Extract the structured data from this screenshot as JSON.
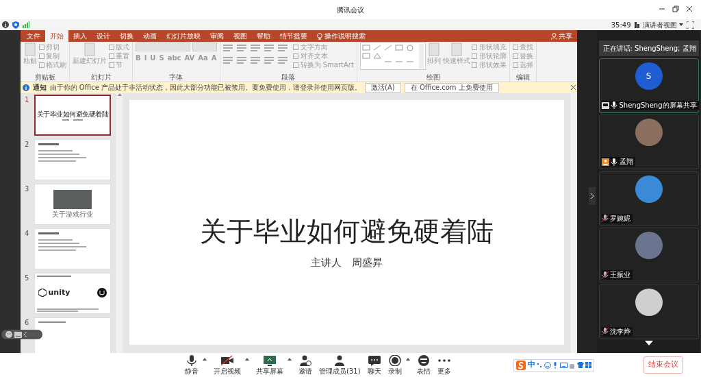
{
  "window": {
    "title": "腾讯会议"
  },
  "status": {
    "timer": "35:49",
    "view_button": "演讲者视图"
  },
  "ppt": {
    "tabs": [
      {
        "label": "文件",
        "selected": false
      },
      {
        "label": "开始",
        "selected": true
      },
      {
        "label": "插入",
        "selected": false
      },
      {
        "label": "设计",
        "selected": false
      },
      {
        "label": "切换",
        "selected": false
      },
      {
        "label": "动画",
        "selected": false
      },
      {
        "label": "幻灯片放映",
        "selected": false
      },
      {
        "label": "审阅",
        "selected": false
      },
      {
        "label": "视图",
        "selected": false
      },
      {
        "label": "帮助",
        "selected": false
      },
      {
        "label": "情节提要",
        "selected": false
      }
    ],
    "search": "操作说明搜索",
    "share": "共享",
    "ribbon_groups": [
      {
        "label": "剪贴板",
        "items": [
          {
            "kind": "large",
            "label": "粘贴"
          },
          {
            "kind": "small",
            "label": "剪切"
          },
          {
            "kind": "small",
            "label": "复制"
          },
          {
            "kind": "small",
            "label": "格式刷"
          }
        ]
      },
      {
        "label": "幻灯片",
        "items": [
          {
            "kind": "large",
            "label": "新建幻灯片"
          },
          {
            "kind": "small",
            "label": "版式"
          },
          {
            "kind": "small",
            "label": "重置"
          },
          {
            "kind": "small",
            "label": "节"
          }
        ]
      },
      {
        "label": "字体",
        "items": [
          {
            "kind": "font",
            "glyphs": [
              "B",
              "I",
              "U",
              "S",
              "abc",
              "AV",
              "Aa",
              "A"
            ]
          }
        ]
      },
      {
        "label": "段落",
        "items": [
          {
            "kind": "paragraph"
          },
          {
            "kind": "small",
            "label": "文字方向"
          },
          {
            "kind": "small",
            "label": "对齐文本"
          },
          {
            "kind": "small",
            "label": "转换为 SmartArt"
          }
        ]
      },
      {
        "label": "绘图",
        "items": [
          {
            "kind": "gallery"
          },
          {
            "kind": "large",
            "label": "排列"
          },
          {
            "kind": "large",
            "label": "快速样式"
          },
          {
            "kind": "small",
            "label": "形状填充"
          },
          {
            "kind": "small",
            "label": "形状轮廓"
          },
          {
            "kind": "small",
            "label": "形状效果"
          }
        ]
      },
      {
        "label": "编辑",
        "items": [
          {
            "kind": "small",
            "label": "查找"
          },
          {
            "kind": "small",
            "label": "替换"
          },
          {
            "kind": "small",
            "label": "选择"
          }
        ]
      }
    ],
    "notice": {
      "title": "通知",
      "message": "由于你的 Office 产品处于非活动状态，因此大部分功能已被禁用。要免费使用，请登录并使用网页版。",
      "buttons": [
        "激活(A)",
        "在 Office.com 上免费使用"
      ]
    },
    "slides": [
      {
        "number": "1",
        "selected": true,
        "kind": "title",
        "title": "关于毕业如何避免硬着陆"
      },
      {
        "number": "2",
        "selected": false,
        "kind": "bullets"
      },
      {
        "number": "3",
        "selected": false,
        "kind": "photo",
        "title": "关于游戏行业"
      },
      {
        "number": "4",
        "selected": false,
        "kind": "bullets"
      },
      {
        "number": "5",
        "selected": false,
        "kind": "logos",
        "title": "unity"
      },
      {
        "number": "6",
        "selected": false,
        "kind": "partial"
      }
    ],
    "current_slide": {
      "title": "关于毕业如何避免硬着陆",
      "presenter_label": "主讲人",
      "presenter": "周盛昇"
    }
  },
  "speaking": "正在讲话: ShengSheng; 孟翔",
  "participants": [
    {
      "name": "ShengSheng的屏幕共享",
      "kind": "screen",
      "initial": "S",
      "muted": false,
      "active": true
    },
    {
      "name": "孟翔",
      "kind": "host",
      "muted": false,
      "active": false
    },
    {
      "name": "罗婉妮",
      "kind": "member",
      "muted": true,
      "active": false
    },
    {
      "name": "王振业",
      "kind": "member",
      "muted": true,
      "active": false
    },
    {
      "name": "沈李烨",
      "kind": "member",
      "muted": true,
      "active": false
    }
  ],
  "toolbar": [
    {
      "label": "静音",
      "dropdown": true
    },
    {
      "label": "开启视频",
      "dropdown": true
    },
    {
      "label": "共享屏幕",
      "dropdown": true
    },
    {
      "label": "邀请",
      "dropdown": false
    },
    {
      "label": "管理成员(31)",
      "dropdown": false
    },
    {
      "label": "聊天",
      "dropdown": false
    },
    {
      "label": "录制",
      "dropdown": true
    },
    {
      "label": "表情",
      "dropdown": false
    },
    {
      "label": "更多",
      "dropdown": false
    }
  ],
  "end_button": "结束会议",
  "ime": {
    "mode": "中"
  }
}
